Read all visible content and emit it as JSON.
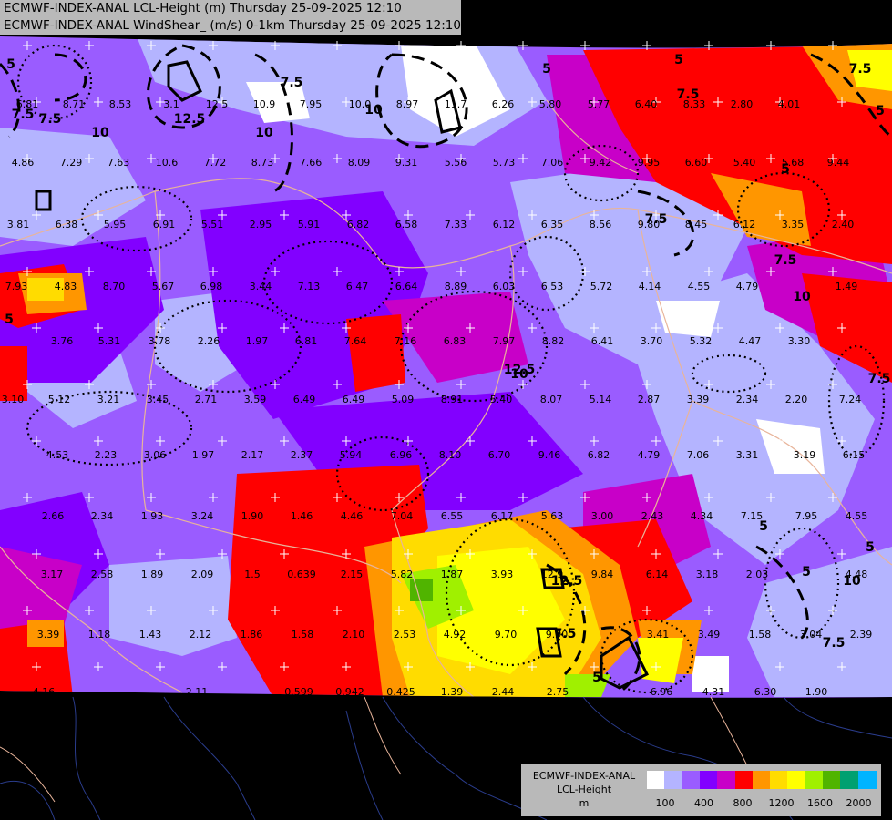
{
  "header": {
    "line1": "ECMWF-INDEX-ANAL LCL-Height (m) Thursday 25-09-2025 12:10",
    "line2": "ECMWF-INDEX-ANAL WindShear_ (m/s) 0-1km Thursday 25-09-2025 12:10"
  },
  "legend": {
    "line1": "ECMWF-INDEX-ANAL",
    "line2": "LCL-Height",
    "line3": "m",
    "colors": [
      "#ffffff",
      "#b4b4ff",
      "#9a5cff",
      "#8200ff",
      "#c800c8",
      "#ff0000",
      "#ff9600",
      "#ffdc00",
      "#ffff00",
      "#a0f000",
      "#50b400",
      "#00a070",
      "#00b4ff"
    ],
    "ticks": [
      "100",
      "400",
      "800",
      "1200",
      "1600",
      "2000"
    ]
  },
  "contour_labels": [
    "7.5",
    "7.5",
    "12.5",
    "10",
    "10",
    "7.5",
    "5",
    "5",
    "7.5",
    "5",
    "7.5",
    "5",
    "5",
    "7.5",
    "10",
    "5",
    "7.5",
    "5",
    "10",
    "5",
    "12.5",
    "7.5",
    "5",
    "10",
    "12.5",
    "7.5",
    "5",
    "7.5",
    "10"
  ],
  "station_values": [
    "6.81",
    "8.71",
    "8.53",
    "3.1",
    "12.5",
    "10.9",
    "7.95",
    "10.0",
    "8.97",
    "11.7",
    "6.26",
    "5.80",
    "5.77",
    "6.40",
    "8.33",
    "2.80",
    "4.01",
    "4.86",
    "7.29",
    "7.63",
    "10.6",
    "7.72",
    "8.73",
    "7.66",
    "8.09",
    "9.31",
    "5.56",
    "5.73",
    "7.06",
    "9.42",
    "9.95",
    "6.60",
    "5.40",
    "5.68",
    "9.44",
    "3.81",
    "6.38",
    "5.95",
    "6.91",
    "5.51",
    "2.95",
    "5.91",
    "6.82",
    "6.58",
    "7.33",
    "6.12",
    "6.35",
    "8.56",
    "9.80",
    "8.45",
    "6.12",
    "3.35",
    "2.40",
    "7.93",
    "4.83",
    "8.70",
    "5.67",
    "6.98",
    "3.44",
    "7.13",
    "6.47",
    "6.64",
    "8.89",
    "6.03",
    "6.53",
    "5.72",
    "4.14",
    "4.55",
    "4.79",
    "1.49",
    "3.76",
    "5.31",
    "3.78",
    "2.26",
    "1.97",
    "6.81",
    "7.64",
    "7.16",
    "6.83",
    "7.97",
    "8.82",
    "6.41",
    "3.70",
    "5.32",
    "4.47",
    "3.30",
    "3.10",
    "5.12",
    "3.21",
    "3.45",
    "2.71",
    "3.59",
    "6.49",
    "6.49",
    "5.09",
    "8.91",
    "5.40",
    "8.07",
    "5.14",
    "2.87",
    "3.39",
    "2.34",
    "2.20",
    "7.24",
    "4.53",
    "2.23",
    "3.06",
    "1.97",
    "2.17",
    "2.37",
    "5.94",
    "6.96",
    "8.10",
    "6.70",
    "9.46",
    "6.82",
    "4.79",
    "7.06",
    "3.31",
    "3.19",
    "6.15",
    "2.66",
    "2.34",
    "1.93",
    "3.24",
    "1.90",
    "1.46",
    "4.46",
    "7.04",
    "6.55",
    "6.17",
    "5.63",
    "3.00",
    "2.43",
    "4.34",
    "7.15",
    "7.95",
    "4.55",
    "3.17",
    "2.58",
    "1.89",
    "2.09",
    "1.5",
    "0.639",
    "2.15",
    "5.82",
    "1.87",
    "3.93",
    "12.9",
    "9.84",
    "6.14",
    "3.18",
    "2.03",
    "4.48",
    "3.39",
    "1.18",
    "1.43",
    "2.12",
    "1.86",
    "1.58",
    "2.10",
    "2.53",
    "4.92",
    "9.70",
    "9.90",
    "3.41",
    "3.49",
    "1.58",
    "3.04",
    "2.39",
    "4.16",
    "2.11",
    "0.599",
    "0.942",
    "0.425",
    "1.39",
    "2.44",
    "2.75",
    "6.96",
    "4.31",
    "6.30",
    "1.90"
  ]
}
